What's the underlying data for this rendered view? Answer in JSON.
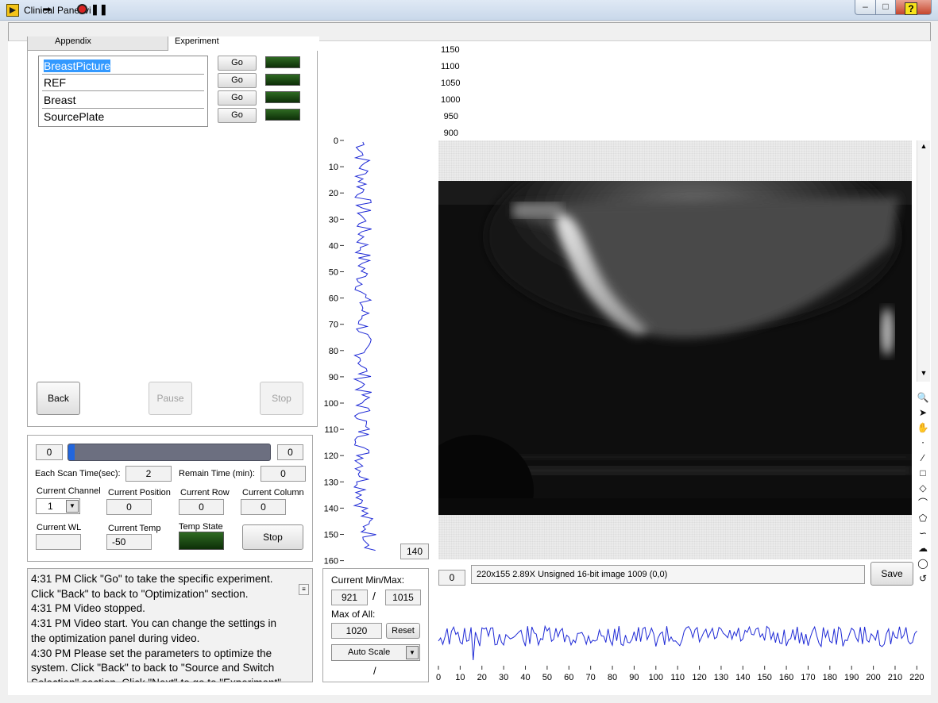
{
  "window": {
    "title": "Clinical Panel.vi",
    "min": "–",
    "max": "□",
    "close": "✕"
  },
  "toolbar": {
    "run": "➡",
    "pause": "❚❚",
    "help": "?"
  },
  "tabs": [
    {
      "label": "Appendix"
    },
    {
      "label": "Experiment"
    }
  ],
  "experiments": [
    {
      "label": "BreastPicture",
      "go": "Go"
    },
    {
      "label": "REF",
      "go": "Go"
    },
    {
      "label": "Breast",
      "go": "Go"
    },
    {
      "label": "SourcePlate",
      "go": "Go"
    }
  ],
  "nav": {
    "back": "Back",
    "pause": "Pause",
    "stop": "Stop"
  },
  "status": {
    "progress_start": "0",
    "progress_end": "0",
    "progress_fraction": 0.03,
    "scan_time_label": "Each Scan Time(sec):",
    "scan_time": "2",
    "remain_label": "Remain Time (min):",
    "remain": "0",
    "channel_label": "Current Channel",
    "channel": "1",
    "position_label": "Current Position",
    "position": "0",
    "row_label": "Current Row",
    "row": "0",
    "column_label": "Current Column",
    "column": "0",
    "wl_label": "Current WL",
    "wl": "",
    "temp_label": "Current Temp",
    "temp": "-50",
    "temp_state_label": "Temp State",
    "stop": "Stop"
  },
  "log": [
    "4:31 PM    Click \"Go\" to take the specific experiment. Click \"Back\" to back to \"Optimization\" section.",
    "4:31 PM    Video stopped.",
    "4:31 PM    Video start. You can change the settings in the optimization panel during video.",
    "4:30 PM    Please set the parameters to optimize the system. Click \"Back\" to back to \"Source and Switch Selection\" section. Click \"Next\" to go to \"Experiment\""
  ],
  "minmax": {
    "title": "Current Min/Max:",
    "min": "921",
    "sep": "/",
    "max": "1015",
    "max_all_label": "Max of All:",
    "max_all": "1020",
    "reset": "Reset",
    "autoscale": "Auto Scale",
    "slash": "/"
  },
  "top_axis_ticks": [
    "1150",
    "1100",
    "1050",
    "1000",
    "950",
    "900"
  ],
  "vertical_profile": {
    "ticks": [
      "0",
      "10",
      "20",
      "30",
      "40",
      "50",
      "60",
      "70",
      "80",
      "90",
      "100",
      "110",
      "120",
      "130",
      "140",
      "150",
      "160"
    ],
    "cursor_value": "140"
  },
  "horizontal_profile": {
    "ticks": [
      "0",
      "10",
      "20",
      "30",
      "40",
      "50",
      "60",
      "70",
      "80",
      "90",
      "100",
      "110",
      "120",
      "130",
      "140",
      "150",
      "160",
      "170",
      "180",
      "190",
      "200",
      "210",
      "220"
    ],
    "cursor_value": "0"
  },
  "image": {
    "info": "220x155 2.89X Unsigned 16-bit image 1009    (0,0)",
    "save": "Save"
  },
  "colors": {
    "trace": "#1f2ad6",
    "led": "#1d4a14",
    "progress": "#2266dd"
  }
}
